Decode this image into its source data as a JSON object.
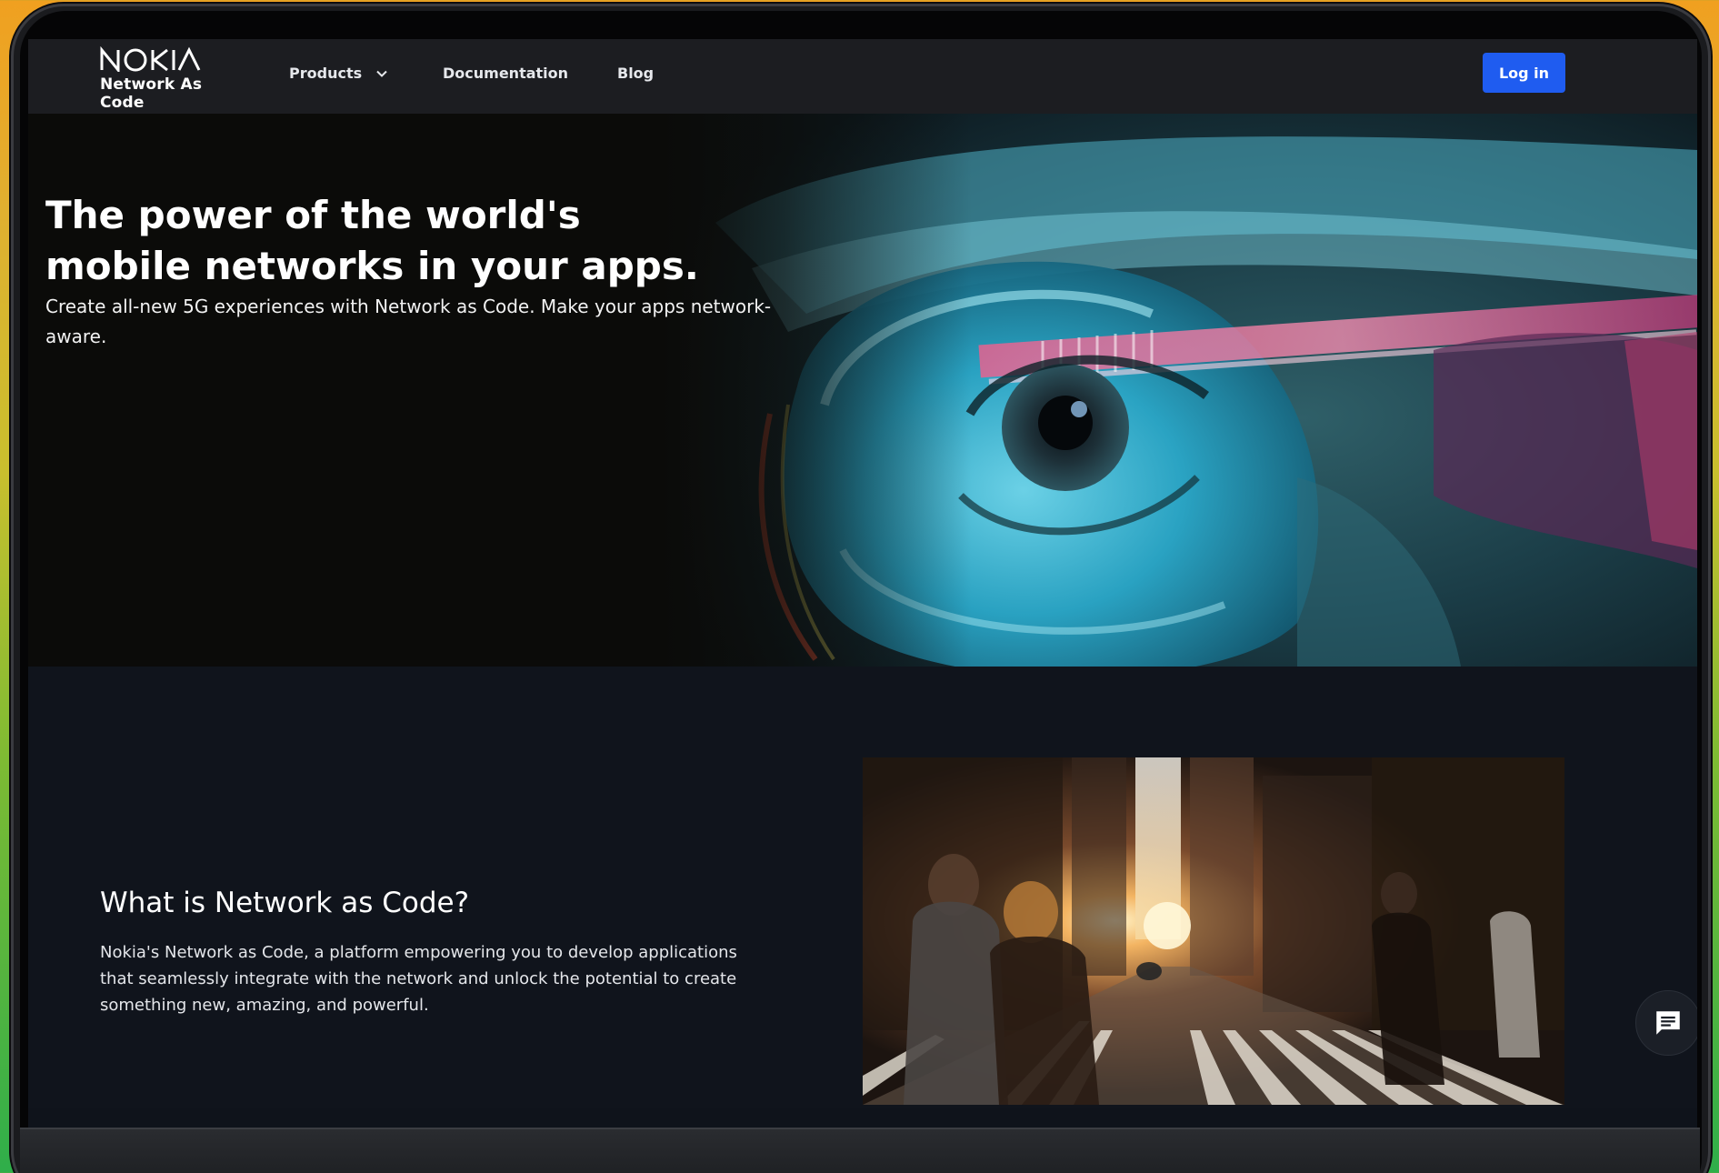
{
  "brand": {
    "logo_text": "NOKIA",
    "subtitle": "Network As Code"
  },
  "nav": {
    "items": [
      {
        "label": "Products",
        "has_dropdown": true
      },
      {
        "label": "Documentation",
        "has_dropdown": false
      },
      {
        "label": "Blog",
        "has_dropdown": false
      }
    ],
    "login_label": "Log in"
  },
  "hero": {
    "title": "The power of the world's mobile networks in your apps.",
    "subtitle": "Create all-new 5G experiences with Network as Code. Make your apps network-aware."
  },
  "about": {
    "title": "What is Network as Code?",
    "body": "Nokia's Network as Code, a platform empowering you to develop applications that seamlessly integrate with the network and unlock the potential to create something new, amazing, and powerful."
  },
  "icons": {
    "chevron": "chevron-down-icon",
    "chat": "chat-icon"
  },
  "colors": {
    "accent": "#1f5cf0",
    "nav_bg": "#1c1d21",
    "section_bg": "#10141c"
  }
}
